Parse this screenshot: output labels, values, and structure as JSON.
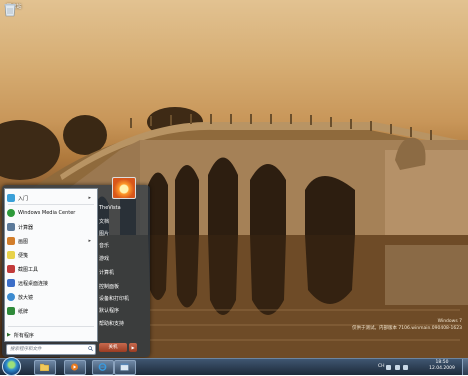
{
  "desktop": {
    "recycle_bin_label": "回收站",
    "watermark": {
      "line1": "仅供于测试。内部版本 7106.winmain.090408-1623",
      "line2": "Windows 7"
    }
  },
  "start_menu": {
    "left_items": [
      {
        "label": "入门",
        "icon": "getting-started-icon",
        "color": "#3aa0d8",
        "submenu": true
      },
      {
        "label": "Windows Media Center",
        "icon": "media-center-icon",
        "color": "#2e9a3a",
        "submenu": false
      },
      {
        "label": "计算器",
        "icon": "calculator-icon",
        "color": "#5c7a9a",
        "submenu": false
      },
      {
        "label": "画图",
        "icon": "paint-icon",
        "color": "#d27d2a",
        "submenu": true
      },
      {
        "label": "便笺",
        "icon": "sticky-notes-icon",
        "color": "#e8d24a",
        "submenu": false
      },
      {
        "label": "截图工具",
        "icon": "snipping-tool-icon",
        "color": "#c23a3a",
        "submenu": false
      },
      {
        "label": "远程桌面连接",
        "icon": "remote-desktop-icon",
        "color": "#3c6ec8",
        "submenu": false
      },
      {
        "label": "放大镜",
        "icon": "magnifier-icon",
        "color": "#3c8bd0",
        "submenu": false
      },
      {
        "label": "纸牌",
        "icon": "solitaire-icon",
        "color": "#2f8a3a",
        "submenu": false
      }
    ],
    "all_programs_label": "所有程序",
    "search_placeholder": "搜索程序和文件",
    "right_items": [
      {
        "label": "TheVista"
      },
      {
        "label": "文档"
      },
      {
        "label": "图片"
      },
      {
        "label": "音乐"
      },
      {
        "label": "游戏"
      },
      {
        "label": "计算机"
      },
      {
        "label": "控制面板"
      },
      {
        "label": "设备和打印机"
      },
      {
        "label": "默认程序"
      },
      {
        "label": "帮助和支持"
      }
    ],
    "shutdown_label": "关机"
  },
  "taskbar": {
    "buttons": [
      {
        "name": "explorer-taskbar-button",
        "icon": "folder-icon"
      },
      {
        "name": "media-player-taskbar-button",
        "icon": "media-player-icon"
      },
      {
        "name": "ie-taskbar-button",
        "icon": "internet-explorer-icon"
      },
      {
        "name": "program-taskbar-button",
        "icon": "window-icon"
      }
    ],
    "tray_language": "CH",
    "clock_time": "18:50",
    "clock_date": "12.04.2009"
  }
}
